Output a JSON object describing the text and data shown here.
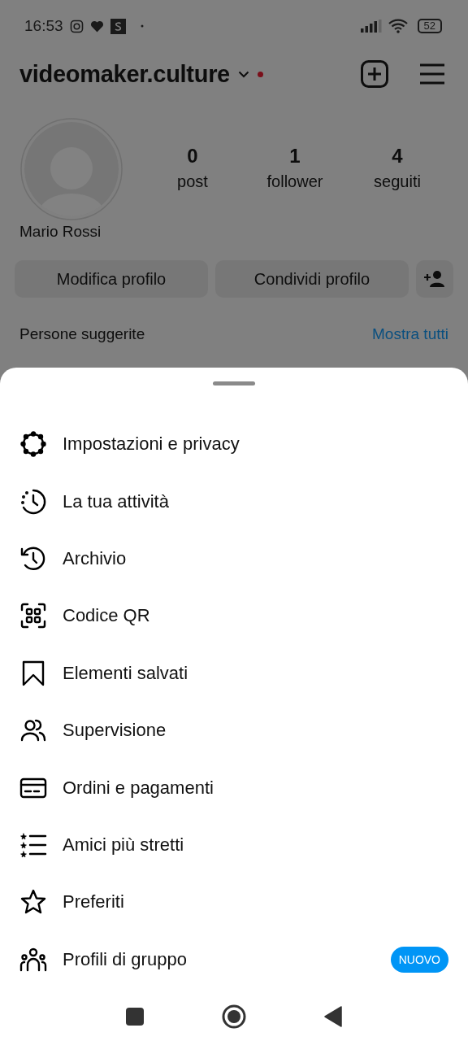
{
  "status_bar": {
    "time": "16:53",
    "battery": "52"
  },
  "header": {
    "username": "videomaker.culture"
  },
  "profile": {
    "name": "Mario Rossi",
    "stats": [
      {
        "value": "0",
        "label": "post"
      },
      {
        "value": "1",
        "label": "follower"
      },
      {
        "value": "4",
        "label": "seguiti"
      }
    ]
  },
  "buttons": [
    "Modifica profilo",
    "Condividi profilo"
  ],
  "suggested": {
    "title": "Persone suggerite",
    "link": "Mostra tutti"
  },
  "menu": [
    {
      "label": "Impostazioni e privacy"
    },
    {
      "label": "La tua attività"
    },
    {
      "label": "Archivio"
    },
    {
      "label": "Codice QR"
    },
    {
      "label": "Elementi salvati"
    },
    {
      "label": "Supervisione"
    },
    {
      "label": "Ordini e pagamenti"
    },
    {
      "label": "Amici più stretti"
    },
    {
      "label": "Preferiti"
    },
    {
      "label": "Profili di gruppo",
      "badge": "NUOVO"
    }
  ]
}
